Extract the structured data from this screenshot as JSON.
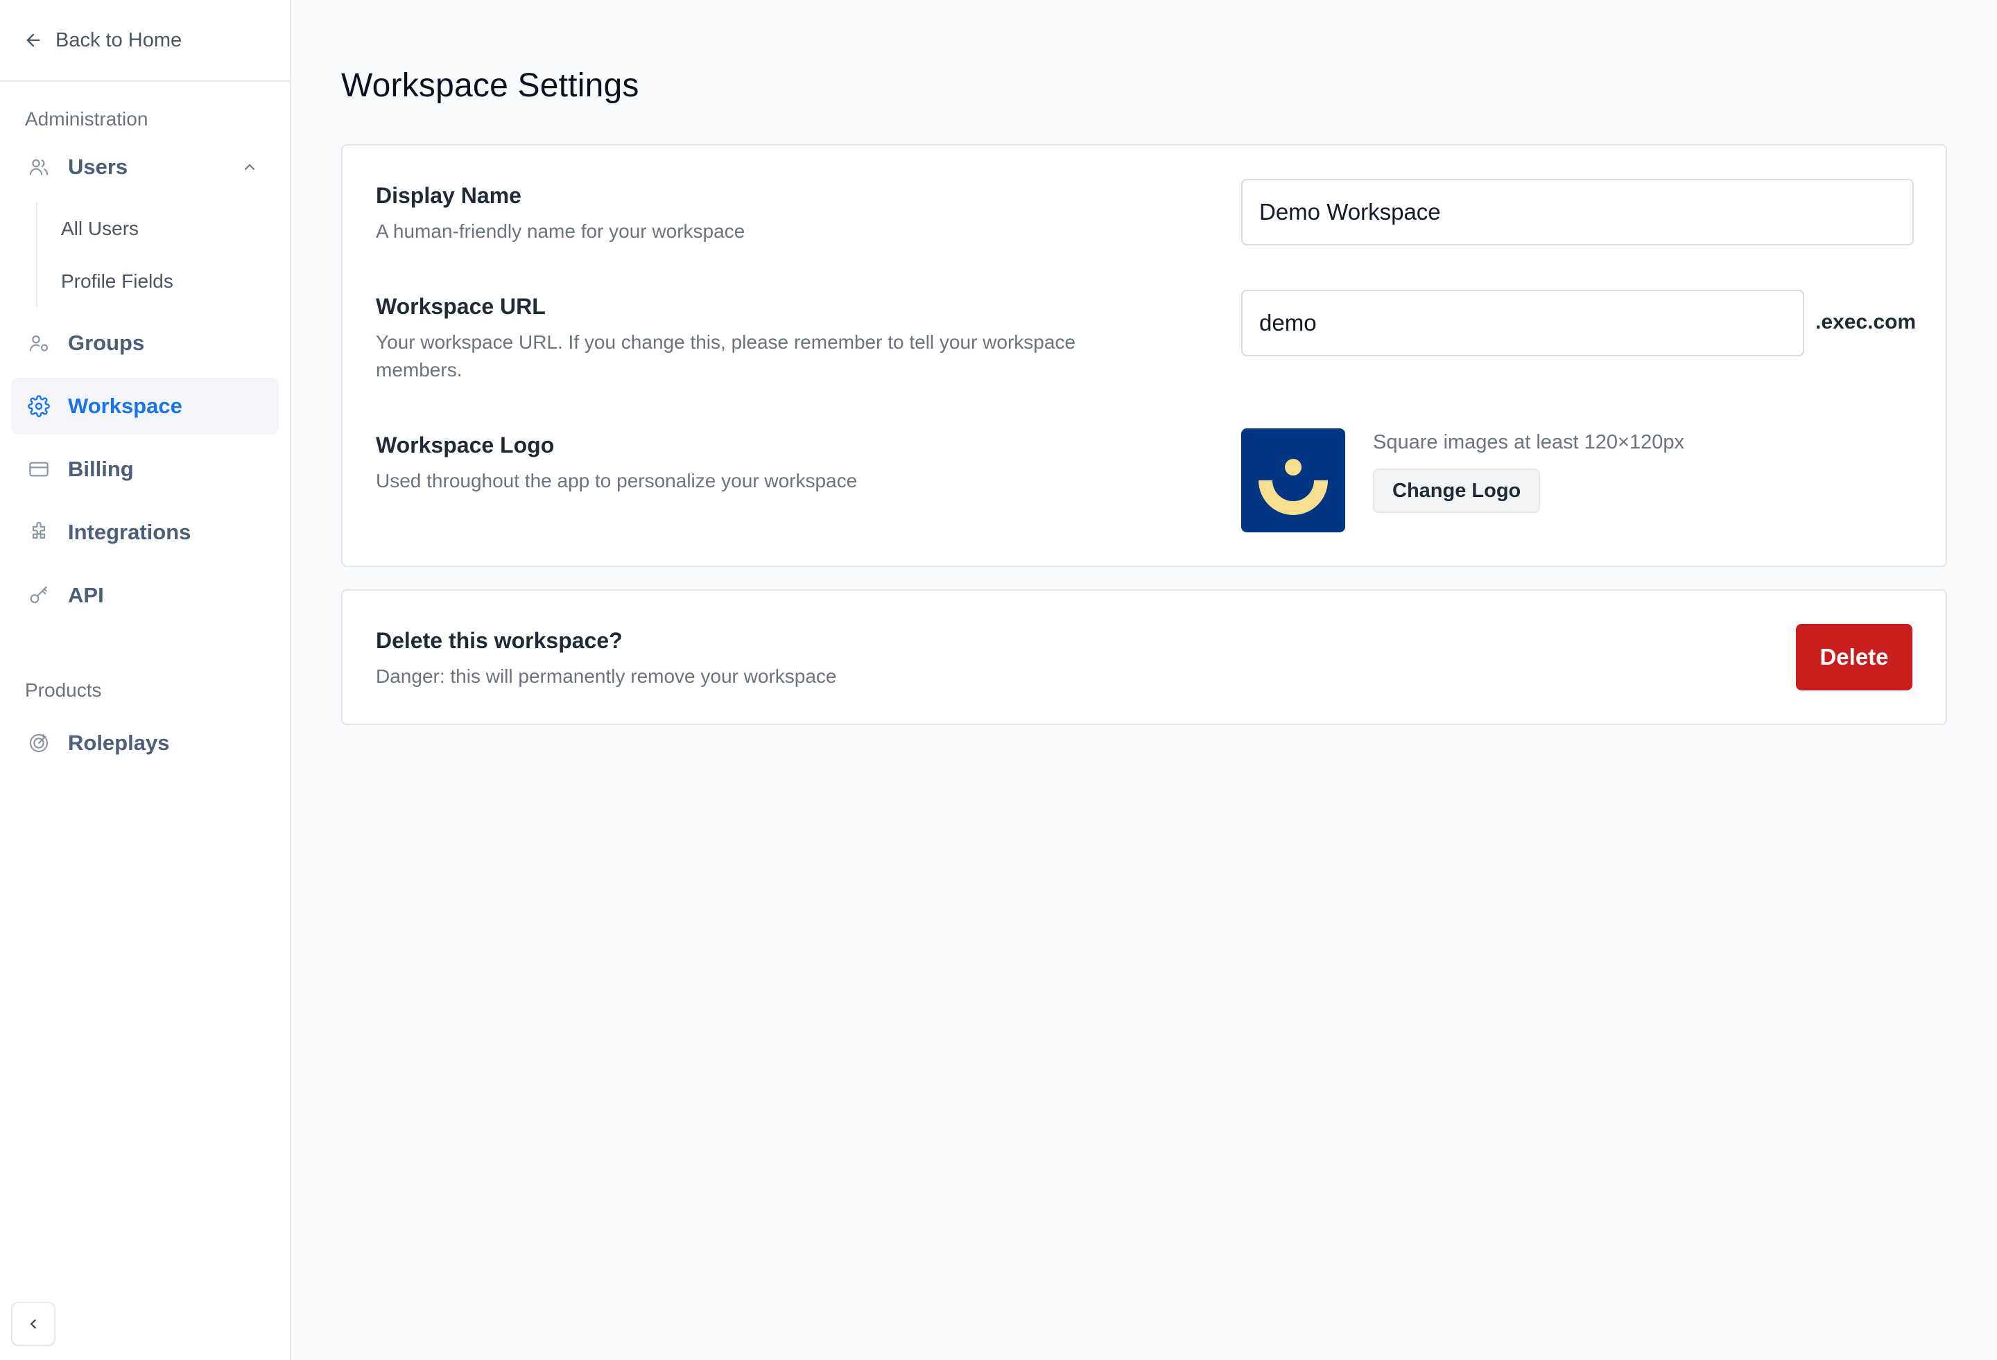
{
  "sidebar": {
    "back_label": "Back to Home",
    "section_admin": "Administration",
    "items": [
      {
        "label": "Users",
        "icon": "users-icon"
      },
      {
        "label": "Groups",
        "icon": "groups-icon"
      },
      {
        "label": "Workspace",
        "icon": "gear-icon",
        "active": true
      },
      {
        "label": "Billing",
        "icon": "credit-card-icon"
      },
      {
        "label": "Integrations",
        "icon": "puzzle-icon"
      },
      {
        "label": "API",
        "icon": "key-icon"
      }
    ],
    "users_sub": [
      "All Users",
      "Profile Fields"
    ],
    "section_products": "Products",
    "products": [
      {
        "label": "Roleplays",
        "icon": "target-icon"
      }
    ]
  },
  "page": {
    "title": "Workspace Settings"
  },
  "settings": {
    "display_name": {
      "title": "Display Name",
      "desc": "A human-friendly name for your workspace",
      "value": "Demo Workspace"
    },
    "workspace_url": {
      "title": "Workspace URL",
      "desc": "Your workspace URL. If you change this, please remember to tell your workspace members.",
      "value": "demo",
      "suffix": ".exec.com"
    },
    "workspace_logo": {
      "title": "Workspace Logo",
      "desc": "Used throughout the app to personalize your workspace",
      "hint": "Square images at least 120×120px",
      "button": "Change Logo"
    }
  },
  "danger": {
    "title": "Delete this workspace?",
    "desc": "Danger: this will permanently remove your workspace",
    "button": "Delete"
  },
  "colors": {
    "accent": "#1a73e8",
    "danger": "#c81e1e",
    "logo_bg": "#023683",
    "logo_fg": "#f6df8f"
  }
}
